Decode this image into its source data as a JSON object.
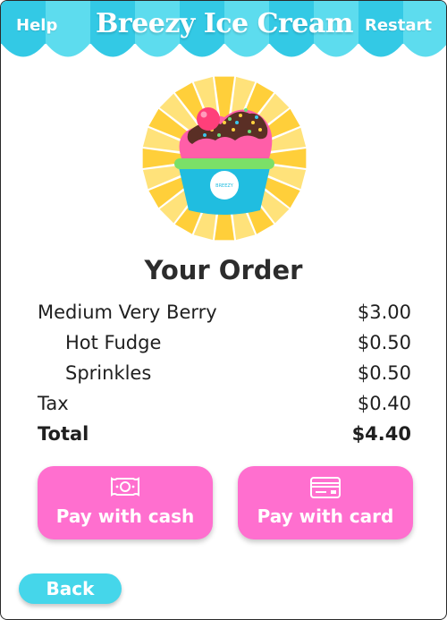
{
  "header": {
    "title": "Breezy Ice Cream",
    "help_label": "Help",
    "restart_label": "Restart",
    "awning_colors": [
      "#33c9e5",
      "#5ddcee"
    ]
  },
  "illustration": {
    "cup_label": "BREEZY"
  },
  "order": {
    "title": "Your Order",
    "items": [
      {
        "label": "Medium Very Berry",
        "amount": "$3.00"
      },
      {
        "label": "Hot Fudge",
        "amount": "$0.50"
      },
      {
        "label": "Sprinkles",
        "amount": "$0.50"
      }
    ],
    "tax": {
      "label": "Tax",
      "amount": "$0.40"
    },
    "total": {
      "label": "Total",
      "amount": "$4.40"
    }
  },
  "actions": {
    "cash": {
      "label": "Pay with cash",
      "icon": "cash-icon"
    },
    "card": {
      "label": "Pay with card",
      "icon": "credit-card-icon"
    },
    "back_label": "Back"
  },
  "colors": {
    "accent_pink": "#ff6fcf",
    "accent_cyan": "#45d6ea"
  }
}
